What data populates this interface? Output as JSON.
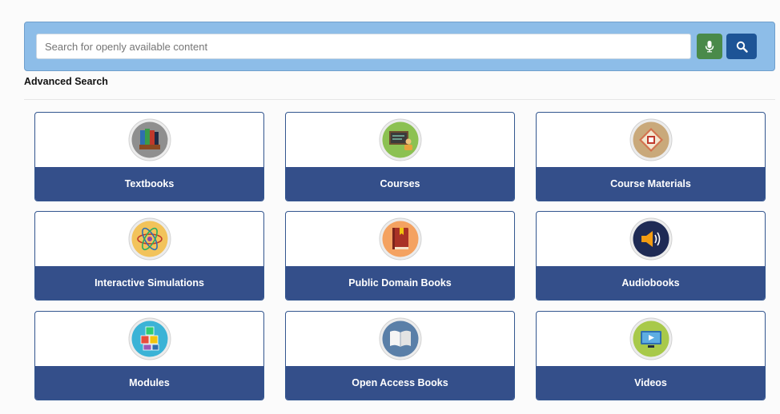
{
  "search": {
    "placeholder": "Search for openly available content",
    "value": "",
    "mic_icon": "microphone-icon",
    "search_icon": "magnifier-icon"
  },
  "advanced_search_label": "Advanced Search",
  "colors": {
    "panel": "#8dbde8",
    "mic_button": "#4a8a4a",
    "search_button": "#1d5496",
    "card_label_bar": "#344f8a"
  },
  "categories": [
    {
      "label": "Textbooks",
      "icon": "books-icon"
    },
    {
      "label": "Courses",
      "icon": "presentation-board-icon"
    },
    {
      "label": "Course Materials",
      "icon": "book-materials-icon"
    },
    {
      "label": "Interactive Simulations",
      "icon": "atom-icon"
    },
    {
      "label": "Public Domain Books",
      "icon": "bookmarked-book-icon"
    },
    {
      "label": "Audiobooks",
      "icon": "speaker-icon"
    },
    {
      "label": "Modules",
      "icon": "number-blocks-icon"
    },
    {
      "label": "Open Access Books",
      "icon": "open-book-icon"
    },
    {
      "label": "Videos",
      "icon": "video-player-icon"
    }
  ]
}
